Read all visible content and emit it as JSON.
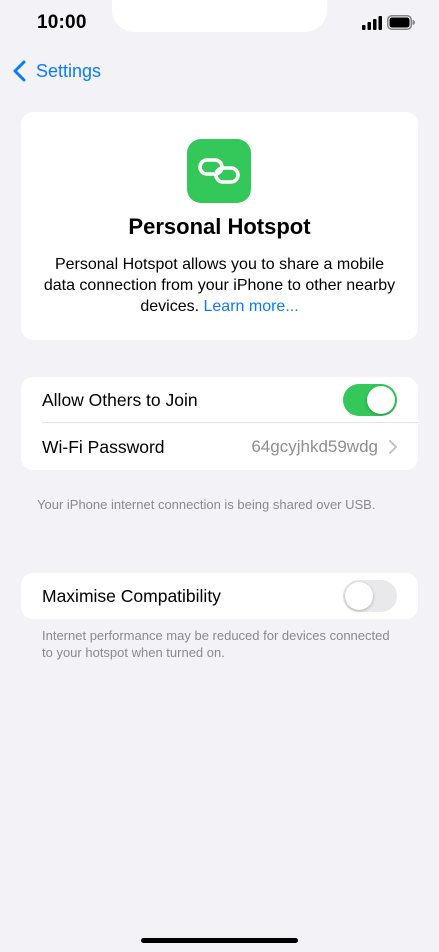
{
  "status_bar": {
    "time": "10:00"
  },
  "nav": {
    "back_label": "Settings"
  },
  "info_card": {
    "title": "Personal Hotspot",
    "description": "Personal Hotspot allows you to share a mobile data connection from your iPhone to other nearby devices.",
    "link_label": "Learn more..."
  },
  "settings": {
    "allow_others": {
      "label": "Allow Others to Join",
      "enabled": true
    },
    "wifi_password": {
      "label": "Wi-Fi Password",
      "value": "64gcyjhkd59wdg"
    }
  },
  "usb_note": "Your iPhone internet connection is being shared over USB.",
  "compatibility": {
    "label": "Maximise Compatibility",
    "enabled": false,
    "note": "Internet performance may be reduced for devices connected to your hotspot when turned on."
  },
  "colors": {
    "accent": "#0a7aff",
    "toggle_on": "#34c759",
    "background": "#f2f2f7"
  }
}
